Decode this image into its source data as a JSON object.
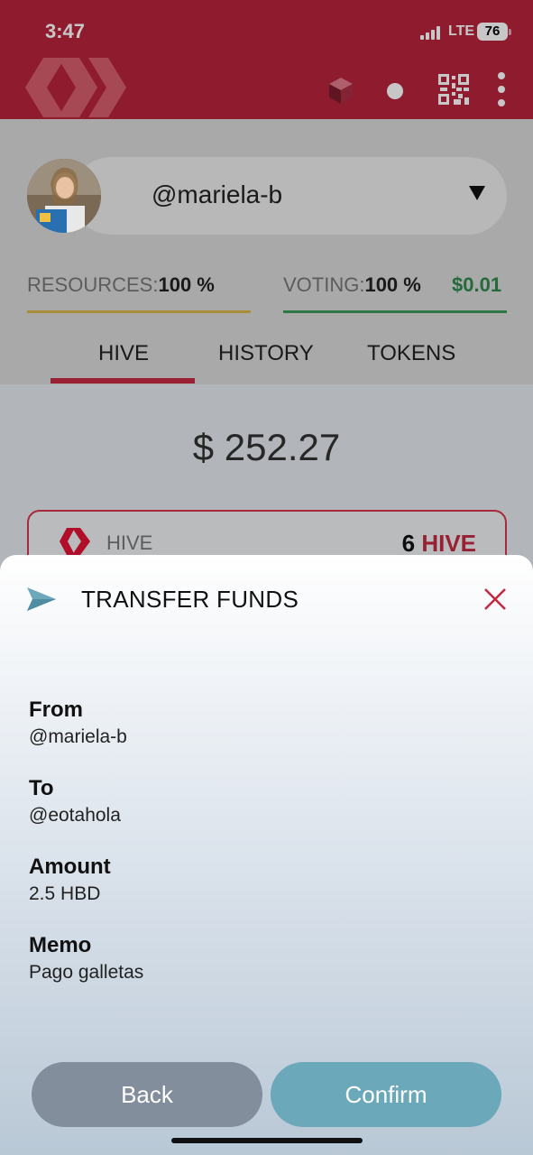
{
  "status_bar": {
    "time": "3:47",
    "network": "LTE",
    "battery": "76"
  },
  "header": {
    "brand_color": "#b8233c"
  },
  "account": {
    "username": "@mariela-b"
  },
  "resources": {
    "label": "RESOURCES:",
    "value": "100 %"
  },
  "voting": {
    "label": "VOTING:",
    "value": "100 %",
    "usd": "$0.01"
  },
  "tabs": [
    {
      "label": "HIVE",
      "active": true
    },
    {
      "label": "HISTORY",
      "active": false
    },
    {
      "label": "TOKENS",
      "active": false
    }
  ],
  "balance": {
    "total": "$ 252.27"
  },
  "hive_card": {
    "label": "HIVE",
    "amount": "6",
    "unit": "HIVE"
  },
  "sheet": {
    "title": "TRANSFER FUNDS",
    "fields": [
      {
        "key": "From",
        "value": "@mariela-b"
      },
      {
        "key": "To",
        "value": "@eotahola"
      },
      {
        "key": "Amount",
        "value": "2.5 HBD"
      },
      {
        "key": "Memo",
        "value": "Pago galletas"
      }
    ],
    "back_label": "Back",
    "confirm_label": "Confirm"
  },
  "colors": {
    "accent": "#c32a41",
    "confirm": "#6aa8ba",
    "back": "#828e9b",
    "voting_usd": "#2f8a4c"
  }
}
